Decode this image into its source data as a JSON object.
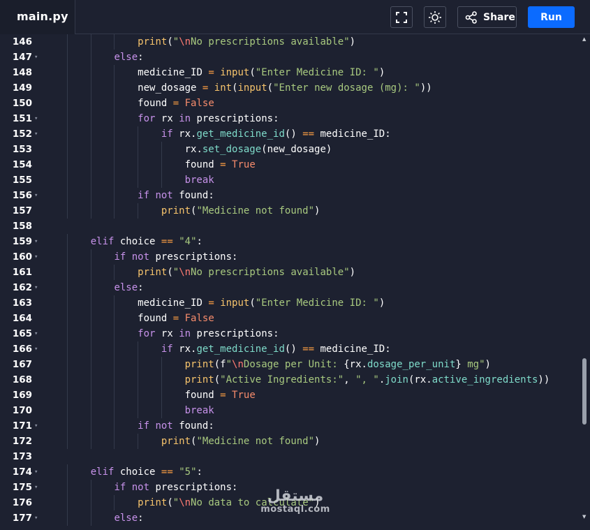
{
  "file_tab": {
    "name": "main.py"
  },
  "toolbar": {
    "fullscreen_icon": "expand-icon",
    "theme_icon": "sun-icon",
    "share_label": "Share",
    "share_icon": "share-icon",
    "run_label": "Run"
  },
  "colors": {
    "run_button": "#0b6bff",
    "background": "#1d2130"
  },
  "watermark": {
    "brand": "مستقل",
    "url": "mostaql.com"
  },
  "lines": [
    {
      "num": "146",
      "text": "            print(\"\\nNo prescriptions available\")"
    },
    {
      "num": "147",
      "text": "        else:"
    },
    {
      "num": "148",
      "text": "            medicine_ID = input(\"Enter Medicine ID: \")"
    },
    {
      "num": "149",
      "text": "            new_dosage = int(input(\"Enter new dosage (mg): \"))"
    },
    {
      "num": "150",
      "text": "            found = False"
    },
    {
      "num": "151",
      "text": "            for rx in prescriptions:"
    },
    {
      "num": "152",
      "text": "                if rx.get_medicine_id() == medicine_ID:"
    },
    {
      "num": "153",
      "text": "                    rx.set_dosage(new_dosage)"
    },
    {
      "num": "154",
      "text": "                    found = True"
    },
    {
      "num": "155",
      "text": "                    break"
    },
    {
      "num": "156",
      "text": "            if not found:"
    },
    {
      "num": "157",
      "text": "                print(\"Medicine not found\")"
    },
    {
      "num": "158",
      "text": ""
    },
    {
      "num": "159",
      "text": "    elif choice == \"4\":"
    },
    {
      "num": "160",
      "text": "        if not prescriptions:"
    },
    {
      "num": "161",
      "text": "            print(\"\\nNo prescriptions available\")"
    },
    {
      "num": "162",
      "text": "        else:"
    },
    {
      "num": "163",
      "text": "            medicine_ID = input(\"Enter Medicine ID: \")"
    },
    {
      "num": "164",
      "text": "            found = False"
    },
    {
      "num": "165",
      "text": "            for rx in prescriptions:"
    },
    {
      "num": "166",
      "text": "                if rx.get_medicine_id() == medicine_ID:"
    },
    {
      "num": "167",
      "text": "                    print(f\"\\nDosage per Unit: {rx.dosage_per_unit} mg\")"
    },
    {
      "num": "168",
      "text": "                    print(\"Active Ingredients:\", \", \".join(rx.active_ingredients))"
    },
    {
      "num": "169",
      "text": "                    found = True"
    },
    {
      "num": "170",
      "text": "                    break"
    },
    {
      "num": "171",
      "text": "            if not found:"
    },
    {
      "num": "172",
      "text": "                print(\"Medicine not found\")"
    },
    {
      "num": "173",
      "text": ""
    },
    {
      "num": "174",
      "text": "    elif choice == \"5\":"
    },
    {
      "num": "175",
      "text": "        if not prescriptions:"
    },
    {
      "num": "176",
      "text": "            print(\"\\nNo data to calculate\")"
    },
    {
      "num": "177",
      "text": "        else:"
    }
  ]
}
